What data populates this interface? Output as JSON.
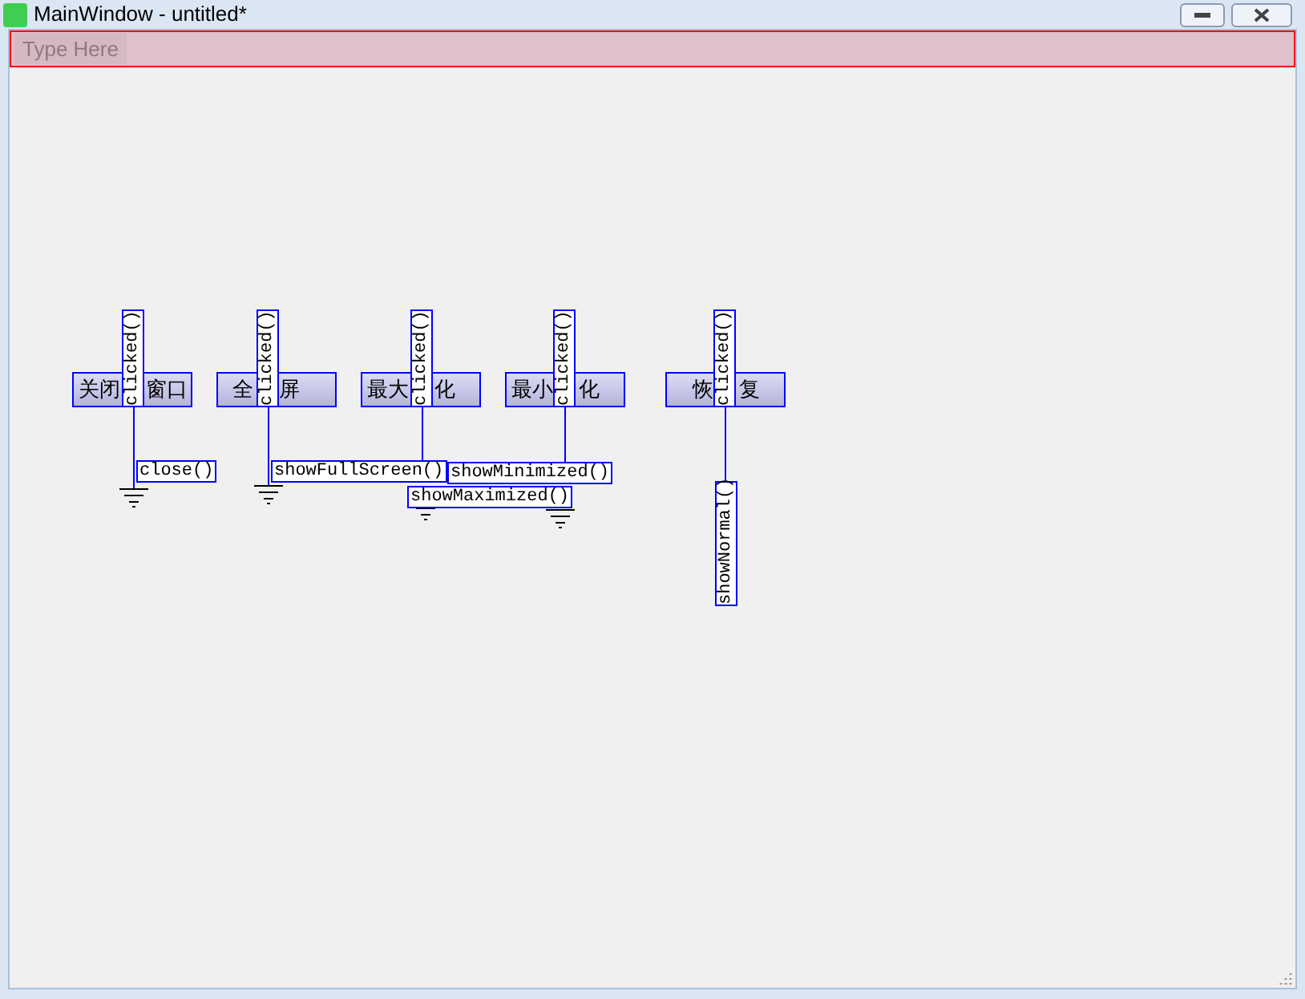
{
  "window": {
    "title": "MainWindow - untitled*"
  },
  "menu_bar": {
    "placeholder": "Type Here"
  },
  "buttons": [
    {
      "label": [
        "关闭",
        "窗口"
      ],
      "signal": "clicked()"
    },
    {
      "label": [
        "全",
        "屏"
      ],
      "signal": "clicked()"
    },
    {
      "label": [
        "最大",
        "化"
      ],
      "signal": "clicked()"
    },
    {
      "label": [
        "最小",
        "化"
      ],
      "signal": "clicked()"
    },
    {
      "label": [
        "恢",
        "复"
      ],
      "signal": "clicked()"
    }
  ],
  "slots": [
    "close()",
    "showFullScreen()",
    "showMinimized()",
    "showMaximized()",
    "showNormal()"
  ]
}
